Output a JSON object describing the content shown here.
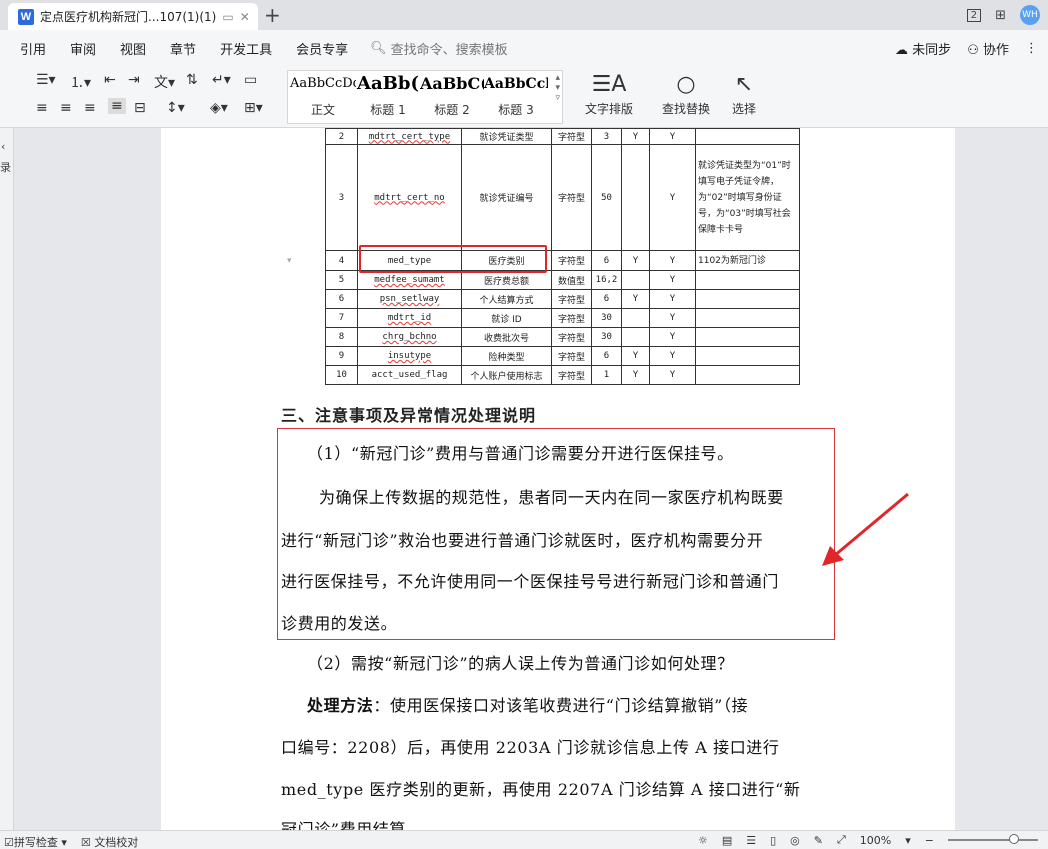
{
  "window": {
    "tab_title": "定点医疗机构新冠门...107(1)(1)",
    "logo": "W",
    "avatar": "WH",
    "layout_badge": "2"
  },
  "menu": {
    "items": [
      "引用",
      "审阅",
      "视图",
      "章节",
      "开发工具",
      "会员专享"
    ],
    "search_placeholder": "查找命令、搜索模板",
    "sync": "未同步",
    "collab": "协作"
  },
  "ribbon": {
    "styles": [
      {
        "preview": "AaBbCcDd",
        "name": "正文"
      },
      {
        "preview": "AaBb(",
        "name": "标题 1"
      },
      {
        "preview": "AaBbC(",
        "name": "标题 2"
      },
      {
        "preview": "AaBbCcl",
        "name": "标题 3"
      }
    ],
    "text_layout": "文字排版",
    "find_replace": "查找替换",
    "select": "选择"
  },
  "sidebar": {
    "label": "录"
  },
  "table": {
    "rows": [
      {
        "no": "2",
        "code": "mdtrt_cert_type",
        "name": "就诊凭证类型",
        "type": "字符型",
        "len": "3",
        "req": "Y",
        "y2": "Y",
        "note": ""
      },
      {
        "no": "3",
        "code": "mdtrt_cert_no",
        "name": "就诊凭证编号",
        "type": "字符型",
        "len": "50",
        "req": "",
        "y2": "Y",
        "note": "就诊凭证类型为“01”时填写电子凭证令牌，为“02”时填写身份证号，为“03”时填写社会保障卡卡号"
      },
      {
        "no": "4",
        "code": "med_type",
        "name": "医疗类别",
        "type": "字符型",
        "len": "6",
        "req": "Y",
        "y2": "Y",
        "note": "1102为新冠门诊"
      },
      {
        "no": "5",
        "code": "medfee_sumamt",
        "name": "医疗费总额",
        "type": "数值型",
        "len": "16,2",
        "req": "",
        "y2": "Y",
        "note": ""
      },
      {
        "no": "6",
        "code": "psn_setlway",
        "name": "个人结算方式",
        "type": "字符型",
        "len": "6",
        "req": "Y",
        "y2": "Y",
        "note": ""
      },
      {
        "no": "7",
        "code": "mdtrt_id",
        "name": "就诊 ID",
        "type": "字符型",
        "len": "30",
        "req": "",
        "y2": "Y",
        "note": ""
      },
      {
        "no": "8",
        "code": "chrg_bchno",
        "name": "收费批次号",
        "type": "字符型",
        "len": "30",
        "req": "",
        "y2": "Y",
        "note": ""
      },
      {
        "no": "9",
        "code": "insutype",
        "name": "险种类型",
        "type": "字符型",
        "len": "6",
        "req": "Y",
        "y2": "Y",
        "note": ""
      },
      {
        "no": "10",
        "code": "acct_used_flag",
        "name": "个人账户使用标志",
        "type": "字符型",
        "len": "1",
        "req": "Y",
        "y2": "Y",
        "note": ""
      }
    ]
  },
  "content": {
    "heading": "三、注意事项及异常情况处理说明",
    "p1": "（1）“新冠门诊”费用与普通门诊需要分开进行医保挂号。",
    "p2_l1": "为确保上传数据的规范性，患者同一天内在同一家医疗机构既要",
    "p2_l2": "进行“新冠门诊”救治也要进行普通门诊就医时，医疗机构需要分开",
    "p2_l3": "进行医保挂号，不允许使用同一个医保挂号号进行新冠门诊和普通门",
    "p2_l4": "诊费用的发送。",
    "p3": "（2）需按“新冠门诊”的病人误上传为普通门诊如何处理？",
    "p4_bold": "处理方法",
    "p4_l1": "：使用医保接口对该笔收费进行“门诊结算撤销”（接",
    "p4_l2": "口编号：2208）后，再使用 2203A 门诊就诊信息上传 A 接口进行",
    "p4_l3": "med_type 医疗类别的更新，再使用 2207A 门诊结算 A 接口进行“新",
    "p4_l4": "冠门诊”费用结算。"
  },
  "status": {
    "spell_check": "拼写检查",
    "doc_check": "文档校对",
    "zoom": "100%",
    "zoom_level": 0.73
  },
  "colors": {
    "highlight": "#e0262a",
    "accent": "#2e6bdf"
  }
}
